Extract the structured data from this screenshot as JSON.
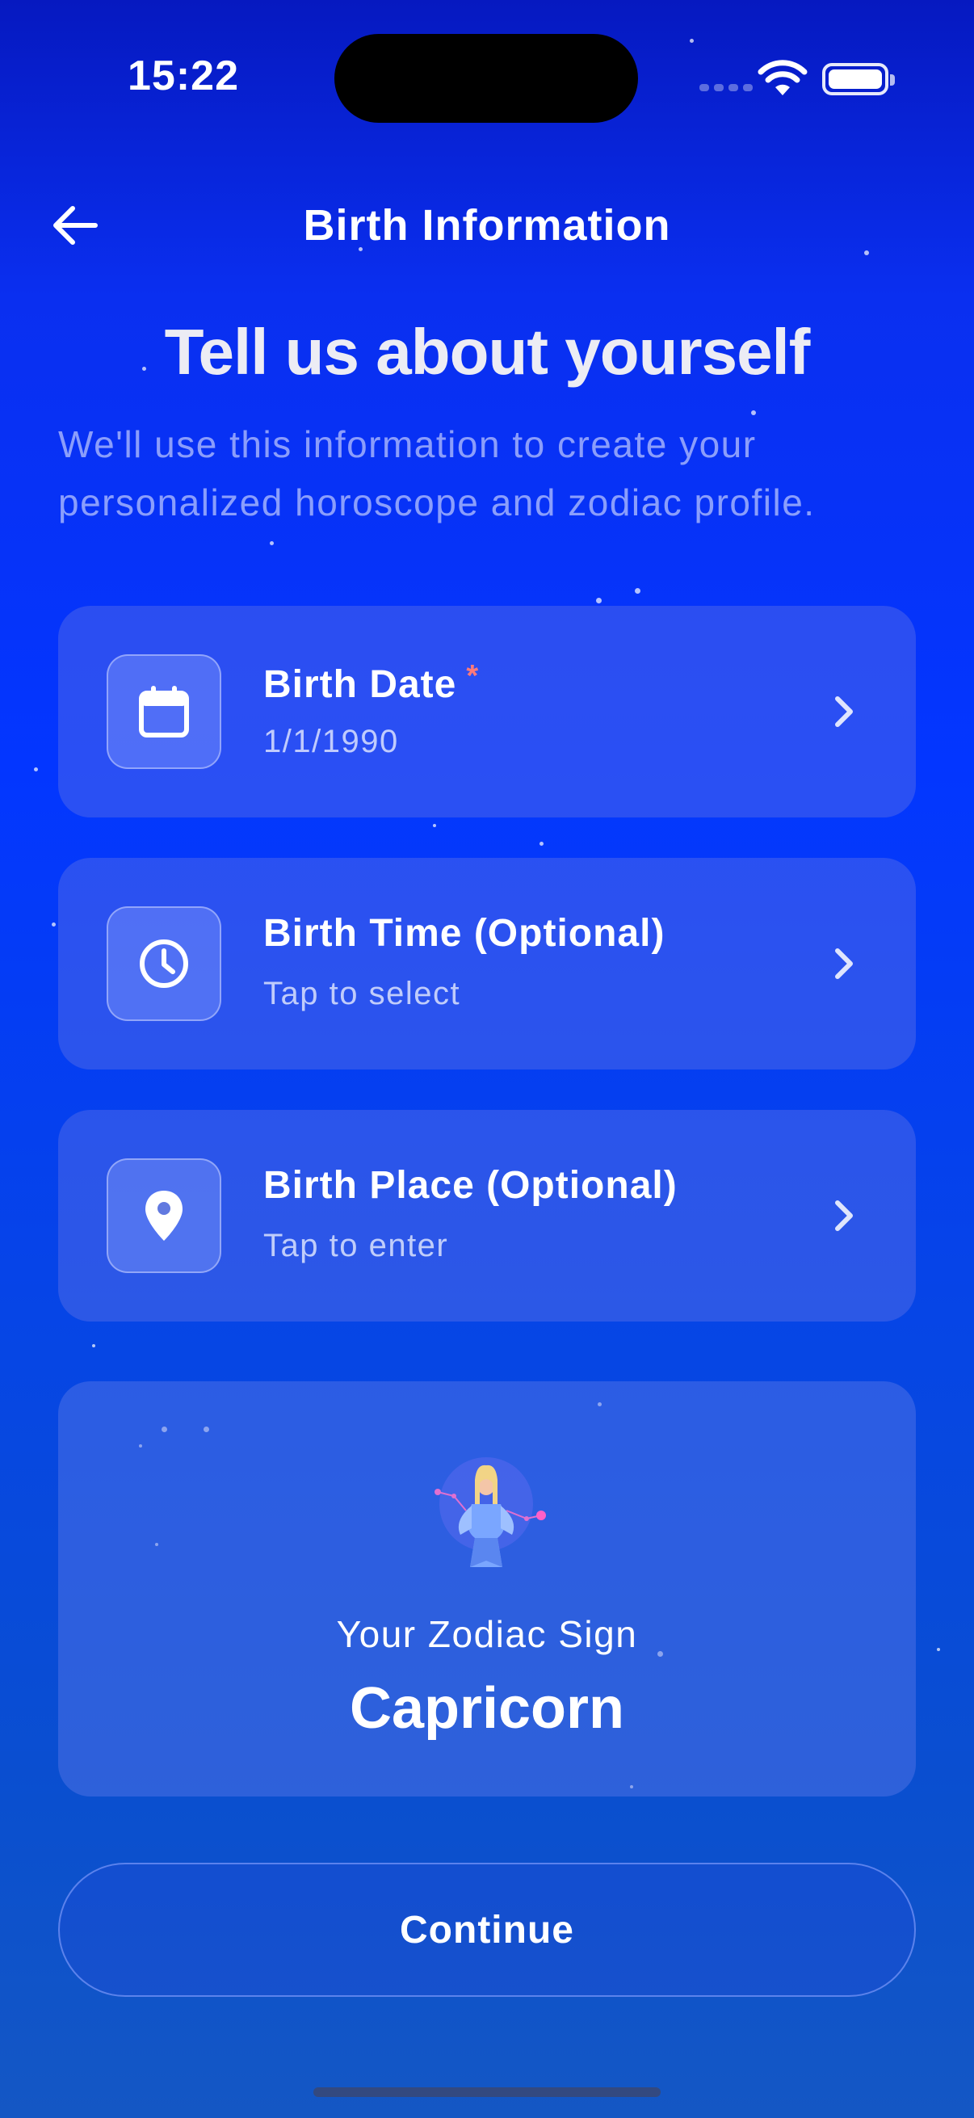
{
  "status": {
    "time": "15:22"
  },
  "header": {
    "title": "Birth Information"
  },
  "intro": {
    "heading": "Tell us about yourself",
    "subtext": "We'll use this information to create your personalized horoscope and zodiac profile."
  },
  "fields": [
    {
      "label": "Birth Date",
      "required_mark": "*",
      "value": "1/1/1990",
      "icon": "calendar-icon"
    },
    {
      "label": "Birth Time (Optional)",
      "value": "Tap to select",
      "icon": "clock-icon"
    },
    {
      "label": "Birth Place (Optional)",
      "value": "Tap to enter",
      "icon": "location-pin-icon"
    }
  ],
  "zodiac": {
    "label": "Your Zodiac Sign",
    "sign": "Capricorn"
  },
  "actions": {
    "continue_label": "Continue"
  },
  "colors": {
    "required": "#ff7a7a",
    "background_top": "#0619c0",
    "background_mid": "#0336ff"
  }
}
